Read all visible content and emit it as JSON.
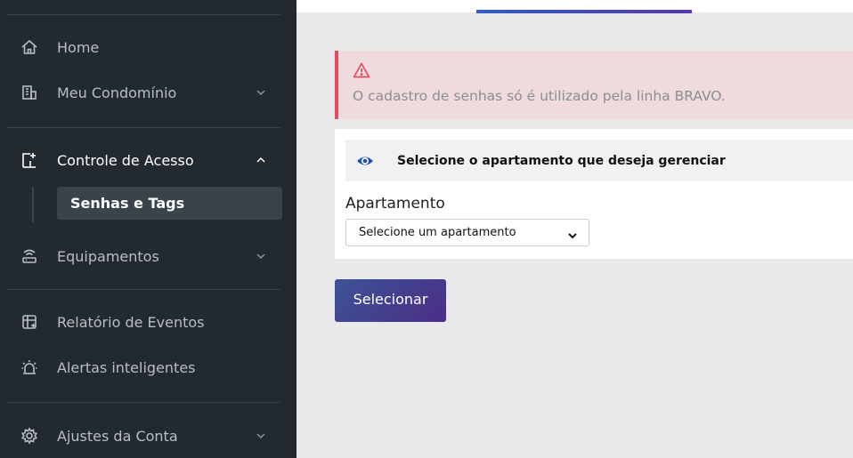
{
  "sidebar": {
    "items": [
      {
        "label": "Home",
        "icon": "home-icon"
      },
      {
        "label": "Meu Condomínio",
        "icon": "building-icon"
      },
      {
        "label": "Controle de Acesso",
        "icon": "door-access-icon"
      },
      {
        "label": "Equipamentos",
        "icon": "router-icon"
      },
      {
        "label": "Relatório de Eventos",
        "icon": "report-table-icon"
      },
      {
        "label": "Alertas inteligentes",
        "icon": "alarm-light-icon"
      },
      {
        "label": "Ajustes da Conta",
        "icon": "gear-icon"
      }
    ],
    "subitem": {
      "label": "Senhas e Tags"
    }
  },
  "alert": {
    "text": "O cadastro de senhas só é utilizado pela linha BRAVO.",
    "color": "#e54b5c"
  },
  "card": {
    "title": "Selecione o apartamento que deseja gerenciar",
    "field_label": "Apartamento",
    "select_value": "Selecione um apartamento"
  },
  "actions": {
    "select_button": "Selecionar"
  },
  "colors": {
    "sidebar_bg": "#222a30",
    "accent_blue": "#2f5ccf",
    "accent_purple": "#4b2e86",
    "eye_icon": "#1f4fb5"
  }
}
